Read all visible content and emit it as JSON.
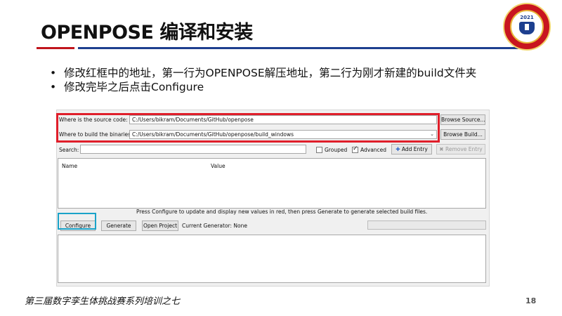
{
  "slide": {
    "title": "OPENPOSE 编译和安装",
    "bullets": [
      "修改红框中的地址，第一行为OPENPOSE解压地址，第二行为刚才新建的build文件夹",
      "修改完毕之后点击Configure"
    ],
    "footer": "第三届数字孪生体挑战赛系列培训之七",
    "page_number": "18",
    "logo_year": "2021",
    "colors": {
      "title_rule_red": "#c0151d",
      "title_rule_blue": "#1e3f8f",
      "annotation_red": "#e01e2a",
      "annotation_blue": "#1aa3c9"
    }
  },
  "cmake": {
    "source_label": "Where is the source code:",
    "source_value": "C:/Users/bikram/Documents/GitHub/openpose",
    "browse_source": "Browse Source...",
    "build_label": "Where to build the binaries:",
    "build_value": "C:/Users/bikram/Documents/GitHub/openpose/build_windows",
    "browse_build": "Browse Build...",
    "search_label": "Search:",
    "search_value": "",
    "grouped_label": "Grouped",
    "grouped_checked": false,
    "advanced_label": "Advanced",
    "advanced_checked": true,
    "add_entry": "Add Entry",
    "remove_entry": "Remove Entry",
    "columns": [
      "Name",
      "Value"
    ],
    "hint": "Press Configure to update and display new values in red, then press Generate to generate selected build files.",
    "configure": "Configure",
    "generate": "Generate",
    "open_project": "Open Project",
    "current_generator": "Current Generator: None"
  }
}
